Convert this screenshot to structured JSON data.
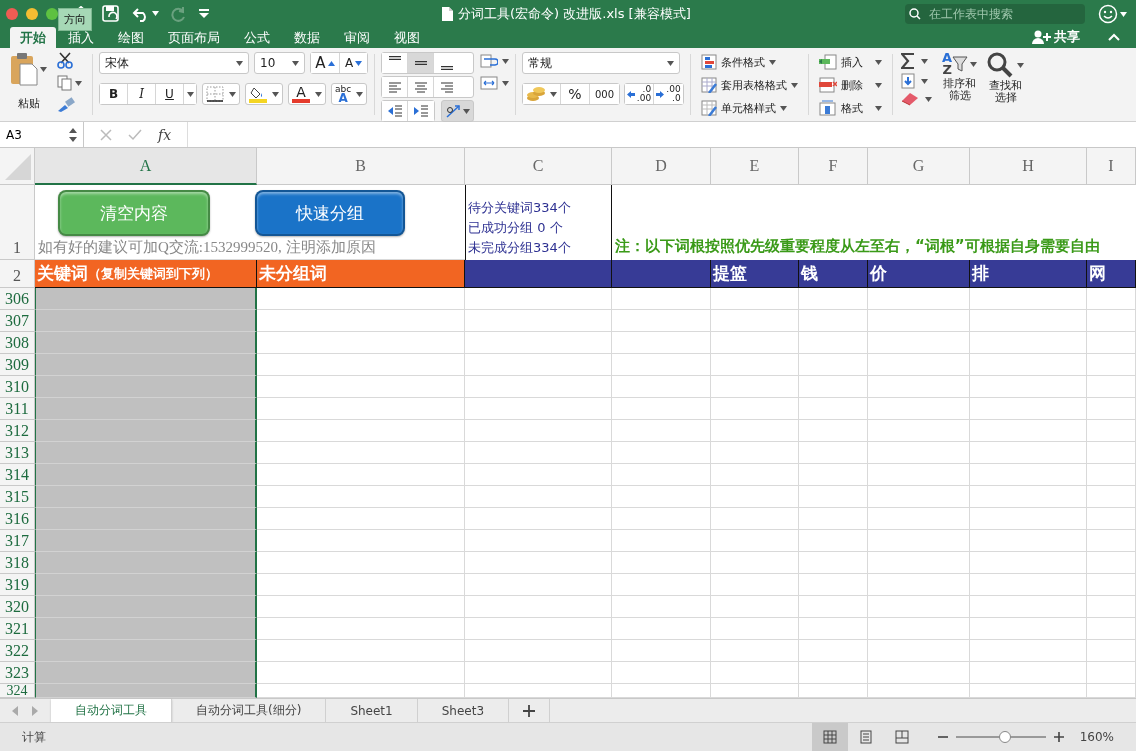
{
  "window": {
    "title": "分词工具(宏命令) 改进版.xls [兼容模式]",
    "search_placeholder": "在工作表中搜索"
  },
  "tooltip": "方向",
  "ribbon_tabs": [
    {
      "label": "开始",
      "selected": true
    },
    {
      "label": "插入",
      "selected": false
    },
    {
      "label": "绘图",
      "selected": false
    },
    {
      "label": "页面布局",
      "selected": false
    },
    {
      "label": "公式",
      "selected": false
    },
    {
      "label": "数据",
      "selected": false
    },
    {
      "label": "审阅",
      "selected": false
    },
    {
      "label": "视图",
      "selected": false
    }
  ],
  "share": "共享",
  "ribbon": {
    "paste": "粘贴",
    "font_name": "宋体",
    "font_size": "10",
    "grow_font": "A",
    "shrink_font": "A",
    "bold": "B",
    "italic": "I",
    "underline": "U",
    "font_color": "A",
    "phonetic_top": "abc",
    "phonetic_bottom": "A",
    "vertical_align": [
      {
        "selected": false
      },
      {
        "selected": true
      },
      {
        "selected": false
      }
    ],
    "number_format": "常规",
    "percent": "%",
    "thousands": "000",
    "decimal_buttons": [
      {
        "top": ".0",
        "bottom": ".00"
      },
      {
        "top": ".00",
        "bottom": ".0"
      }
    ],
    "styles": [
      "条件格式",
      "套用表格格式",
      "单元格样式"
    ],
    "cells": [
      "插入",
      "删除",
      "格式"
    ],
    "sort_letters": [
      "A",
      "Z"
    ],
    "sort": "排序和筛选",
    "find": "查找和选择"
  },
  "formula_bar": {
    "name_box": "A3",
    "function_label": "fx"
  },
  "columns": [
    {
      "label": "A",
      "selected": true
    },
    {
      "label": "B",
      "selected": false
    },
    {
      "label": "C",
      "selected": false
    },
    {
      "label": "D",
      "selected": false
    },
    {
      "label": "E",
      "selected": false
    },
    {
      "label": "F",
      "selected": false
    },
    {
      "label": "G",
      "selected": false
    },
    {
      "label": "H",
      "selected": false
    },
    {
      "label": "I",
      "selected": false
    }
  ],
  "row1": {
    "number": "1",
    "buttons": [
      {
        "label": "清空内容",
        "color": "#5cb85c"
      },
      {
        "label": "快速分组",
        "color": "#1a73c8"
      }
    ],
    "suggestion": "如有好的建议可加Q交流:1532999520, 注明添加原因",
    "stats": [
      "待分关键词334个",
      "已成功分组 0 个",
      "未完成分组334个"
    ],
    "note": "注：以下词根按照优先级重要程度从左至右，“词根”可根据自身需要自由"
  },
  "row2": {
    "number": "2",
    "cells": [
      {
        "text": "关键词",
        "hint": "（复制关键词到下列）",
        "color": "#f26522"
      },
      {
        "text": "未分组词",
        "color": "#f26522"
      },
      {
        "text": "",
        "color": "#373b96"
      },
      {
        "text": "",
        "color": "#373b96"
      },
      {
        "text": "提篮",
        "color": "#373b96"
      },
      {
        "text": "钱",
        "color": "#373b96"
      },
      {
        "text": "价",
        "color": "#373b96"
      },
      {
        "text": "排",
        "color": "#373b96"
      },
      {
        "text": "网",
        "color": "#373b96"
      }
    ]
  },
  "rows": [
    "306",
    "307",
    "308",
    "309",
    "310",
    "311",
    "312",
    "313",
    "314",
    "315",
    "316",
    "317",
    "318",
    "319",
    "320",
    "321",
    "322",
    "323",
    "324"
  ],
  "sheet_tabs": [
    {
      "label": "自动分词工具",
      "selected": true
    },
    {
      "label": "自动分词工具(细分)",
      "selected": false
    },
    {
      "label": "Sheet1",
      "selected": false
    },
    {
      "label": "Sheet3",
      "selected": false
    }
  ],
  "status_bar": {
    "mode": "计算",
    "views": [
      {
        "selected": true
      },
      {
        "selected": false
      },
      {
        "selected": false
      }
    ],
    "zoom": {
      "level": 0.55
    },
    "zoom_label": "160%"
  }
}
